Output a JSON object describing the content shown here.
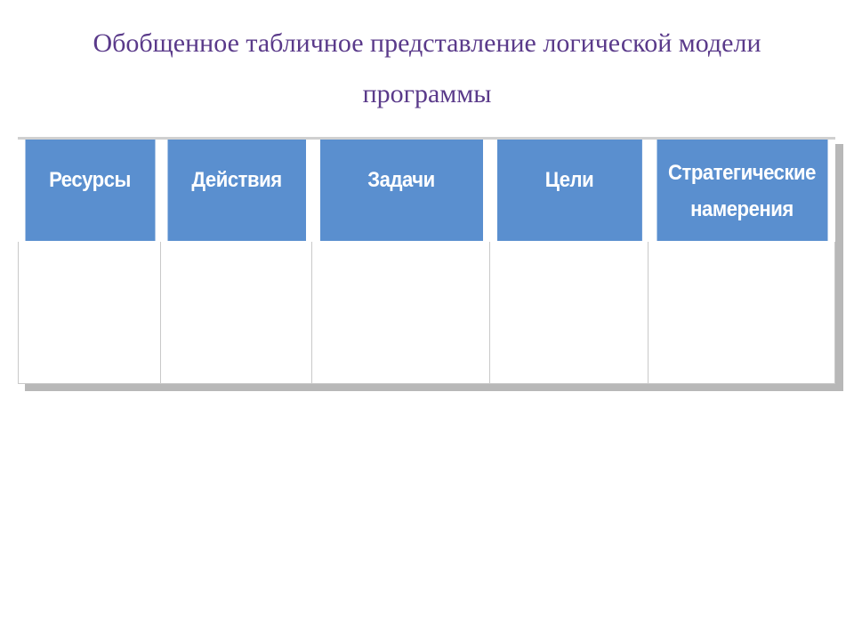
{
  "title": "Обобщенное табличное представление логической модели программы",
  "table": {
    "headers": [
      "Ресурсы",
      "Действия",
      "Задачи",
      "Цели",
      "Стратегические намерения"
    ],
    "rows": [
      [
        "",
        "",
        "",
        "",
        ""
      ]
    ]
  },
  "colors": {
    "title": "#5a3a8a",
    "header_bg": "#5a8fcf",
    "header_fg": "#ffffff",
    "shadow": "#b8b8b8"
  }
}
